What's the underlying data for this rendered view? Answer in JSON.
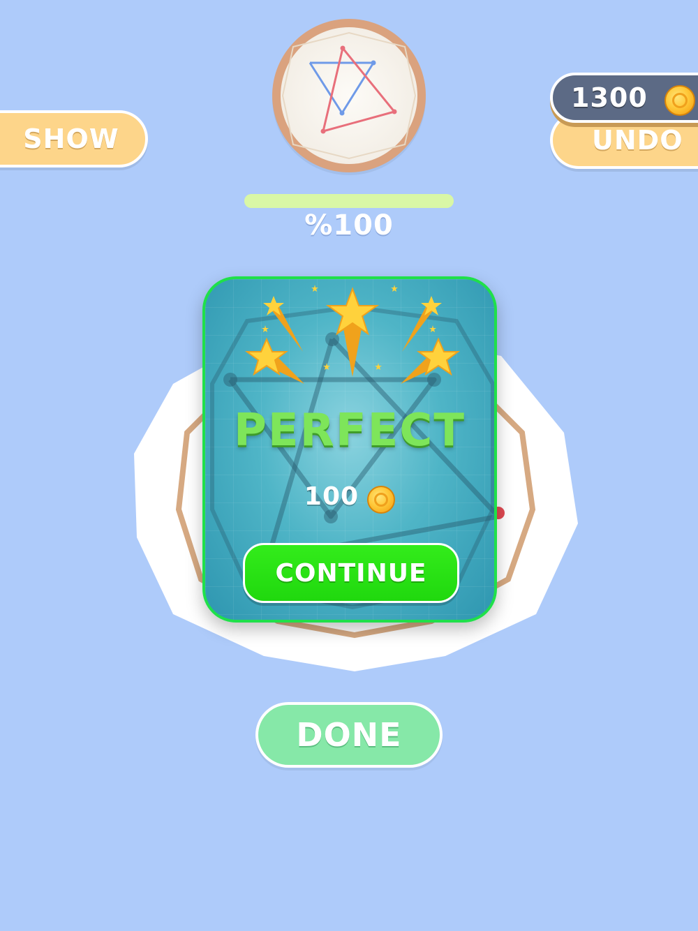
{
  "toolbar": {
    "show_label": "SHOW",
    "undo_label": "UNDO",
    "coins": "1300",
    "coin_icon": "gold-coin"
  },
  "progress": {
    "percent": 100,
    "label": "%100"
  },
  "result": {
    "title": "PERFECT",
    "reward_amount": "100",
    "continue_label": "CONTINUE"
  },
  "footer": {
    "done_label": "DONE"
  },
  "colors": {
    "background": "#aecbfa",
    "button_yellow": "#fdd58a",
    "continue_green": "#20d80e",
    "done_green": "#86e8a8",
    "popup_border": "#1fe04a",
    "target_line_blue": "#6f9ae8",
    "target_line_red": "#e86f7b"
  }
}
